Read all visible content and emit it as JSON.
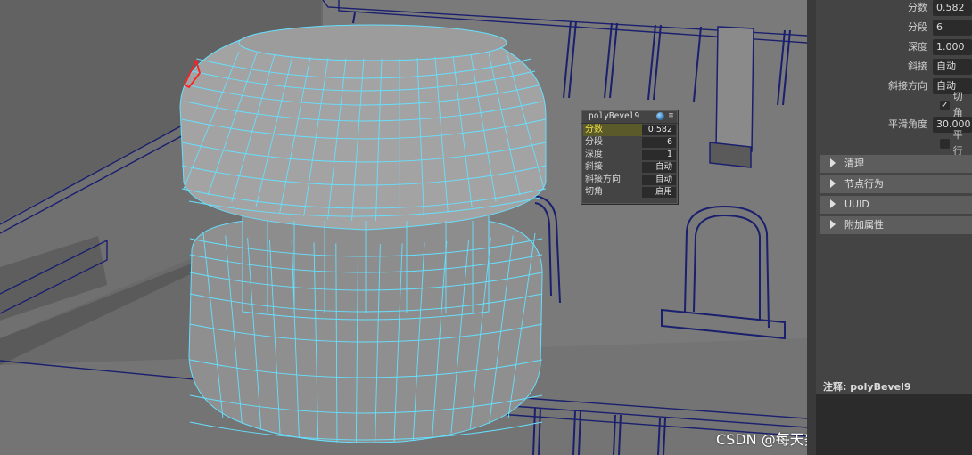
{
  "colors": {
    "wireframe": "#66e0ff",
    "edge_dark": "#1a1f6e",
    "selected_edge": "#ff2020",
    "hud_highlight": "#f0e24a"
  },
  "hud": {
    "title": "polyBevel9",
    "globe_icon": "globe-icon",
    "menu_icon": "≡",
    "rows": [
      {
        "label": "分数",
        "value": "0.582"
      },
      {
        "label": "分段",
        "value": "6"
      },
      {
        "label": "深度",
        "value": "1"
      },
      {
        "label": "斜接",
        "value": "自动"
      },
      {
        "label": "斜接方向",
        "value": "自动"
      },
      {
        "label": "切角",
        "value": "启用"
      }
    ]
  },
  "panel": {
    "attributes": [
      {
        "label": "分数",
        "value": "0.582"
      },
      {
        "label": "分段",
        "value": "6"
      },
      {
        "label": "深度",
        "value": "1.000"
      },
      {
        "label": "斜接",
        "value": "自动"
      },
      {
        "label": "斜接方向",
        "value": "自动"
      }
    ],
    "chamfer": {
      "checked": true,
      "label": "切角"
    },
    "smooth_angle": {
      "label": "平滑角度",
      "value": "30.000"
    },
    "parallel": {
      "checked": false,
      "label": "平行"
    },
    "sections": [
      "清理",
      "节点行为",
      "UUID",
      "附加属性"
    ],
    "notes_label": "注释: polyBevel9"
  },
  "watermark": "CSDN @每天努力一点点，哈哈"
}
